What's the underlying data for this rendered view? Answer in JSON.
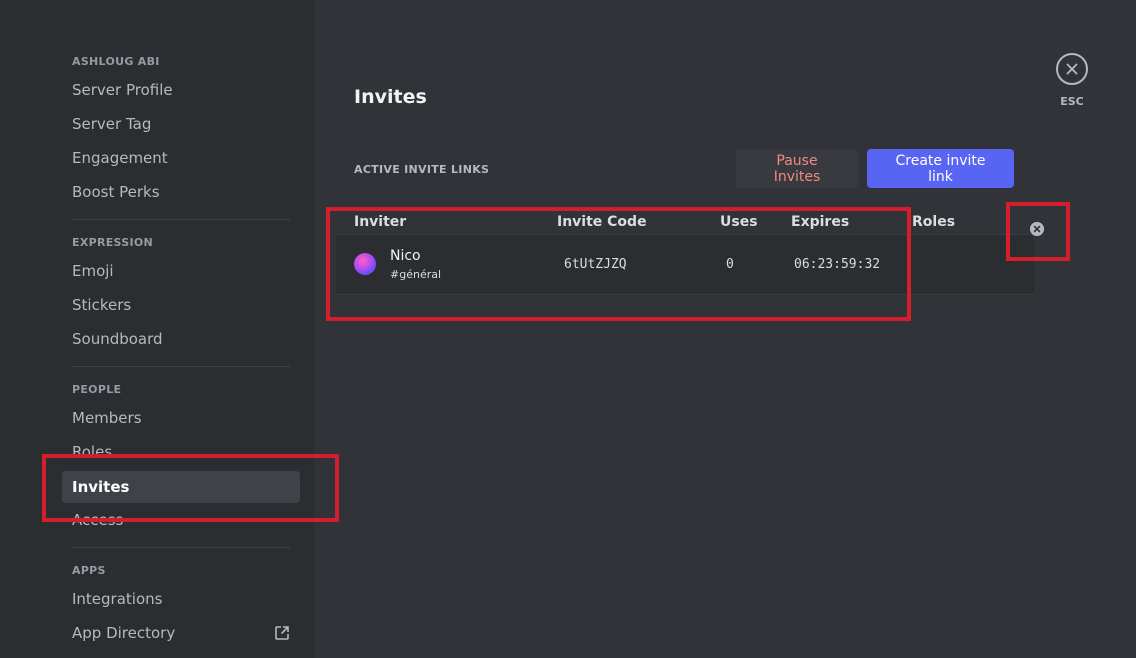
{
  "sidebar": {
    "sections": [
      {
        "header": "ASHLOUG ABI",
        "items": [
          "Server Profile",
          "Server Tag",
          "Engagement",
          "Boost Perks"
        ]
      },
      {
        "header": "EXPRESSION",
        "items": [
          "Emoji",
          "Stickers",
          "Soundboard"
        ]
      },
      {
        "header": "PEOPLE",
        "items": [
          "Members",
          "Roles",
          "Invites",
          "Access"
        ]
      },
      {
        "header": "APPS",
        "items": [
          "Integrations",
          "App Directory"
        ]
      }
    ],
    "active_item": "Invites",
    "external_link_icon": "external-link-icon"
  },
  "main": {
    "title": "Invites",
    "subheader": "ACTIVE INVITE LINKS",
    "pause_button": "Pause Invites",
    "create_button": "Create invite link",
    "table": {
      "headers": [
        "Inviter",
        "Invite Code",
        "Uses",
        "Expires",
        "Roles"
      ],
      "rows": [
        {
          "inviter": "Nico",
          "channel": "#général",
          "code": "6tUtZJZQ",
          "uses": "0",
          "expires": "06:23:59:32",
          "roles": ""
        }
      ]
    },
    "esc_label": "ESC"
  },
  "colors": {
    "accent": "#5865f2",
    "danger_text": "#f28a7f",
    "annotation_red": "#d21f2b",
    "sidebar_bg": "#2b2d31",
    "main_bg": "#313338"
  }
}
